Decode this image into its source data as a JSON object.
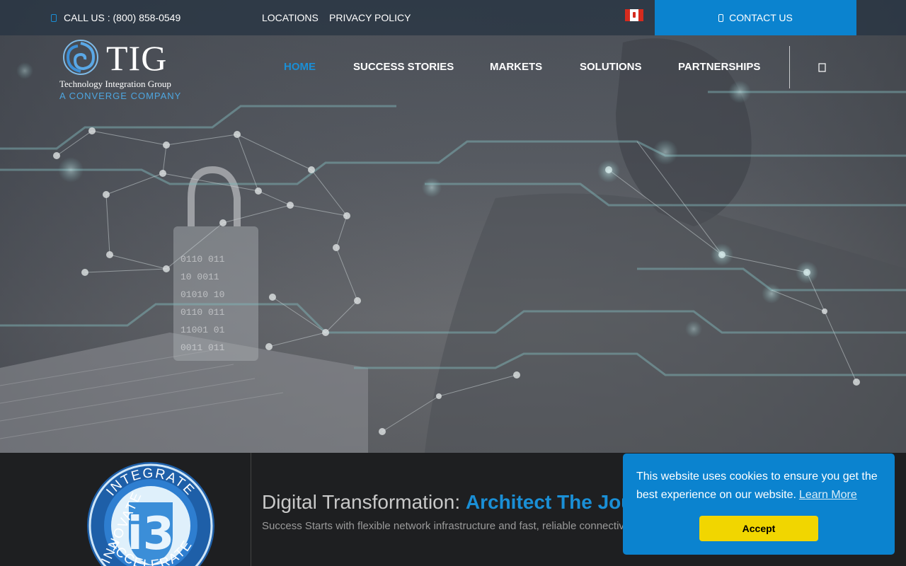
{
  "topbar": {
    "phone": "CALL US : (800) 858-0549",
    "links": [
      "LOCATIONS",
      "PRIVACY POLICY"
    ],
    "contact_label": "CONTACT US",
    "flag_icon": "canada-flag-icon"
  },
  "logo": {
    "mark": "TIG",
    "name": "Technology Integration Group",
    "tagline": "A CONVERGE COMPANY"
  },
  "nav": {
    "items": [
      "HOME",
      "SUCCESS STORIES",
      "MARKETS",
      "SOLUTIONS",
      "PARTNERSHIPS"
    ],
    "active": "HOME",
    "search_icon": "search-icon"
  },
  "badge": {
    "center": "i3",
    "ring_top": "INTEGRATE",
    "ring_left": "INNOVATE",
    "ring_bottom": "ACCELERATE"
  },
  "feature": {
    "headline_prefix": "Digital Transformation: ",
    "headline_highlight": "Architect The Journey",
    "subline": "Success Starts with flexible network infrastructure and fast, reliable connectivity"
  },
  "cookie": {
    "message": "This website uses cookies to ensure you get the best experience on our website.",
    "learn_more": "Learn More",
    "accept": "Accept"
  },
  "colors": {
    "accent": "#0b83cf",
    "accept_button": "#f1d600",
    "band_bg": "#1e1f21"
  }
}
